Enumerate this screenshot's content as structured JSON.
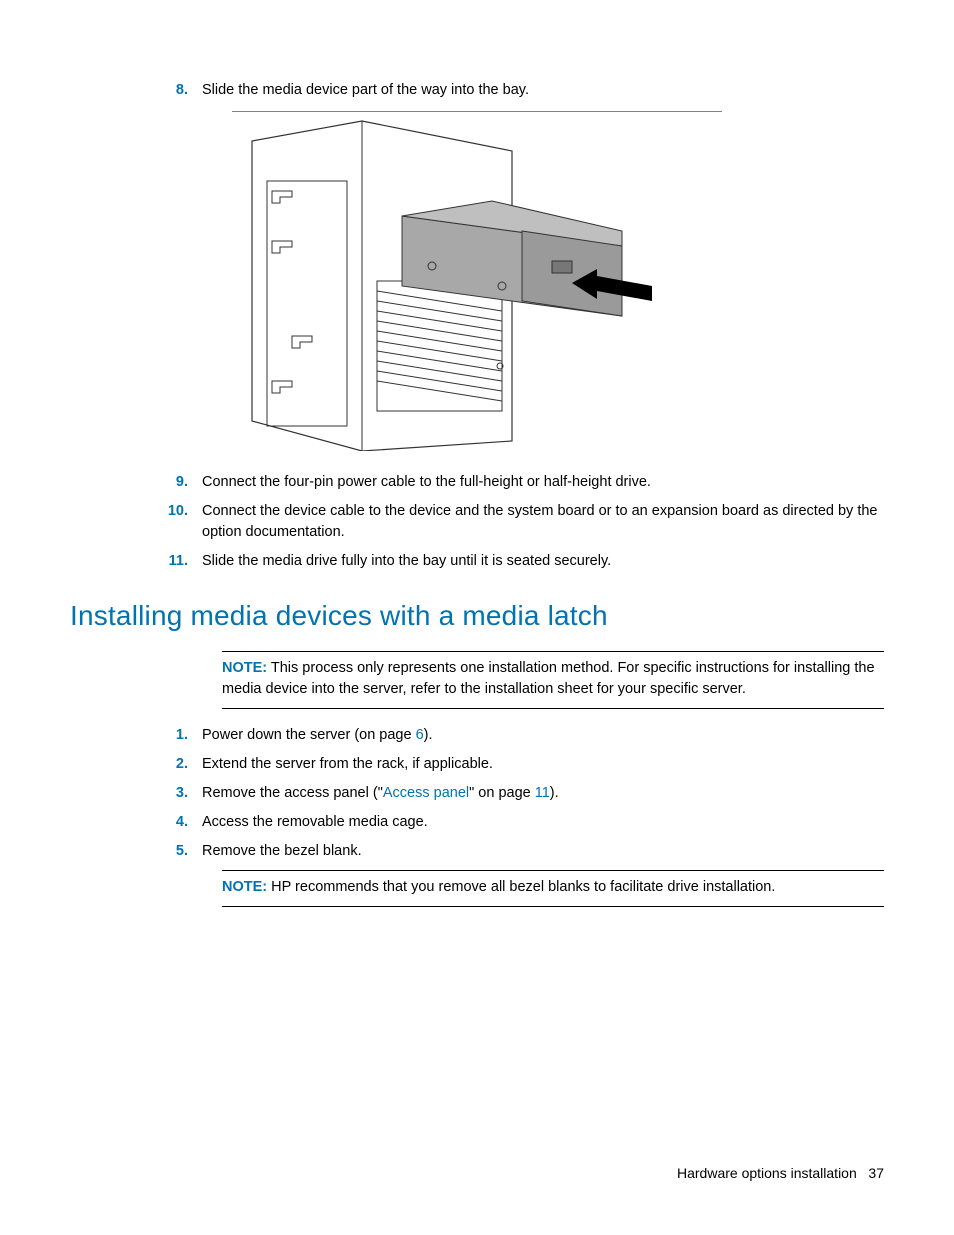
{
  "steps_a": {
    "s8": {
      "num": "8.",
      "text": "Slide the media device part of the way into the bay."
    },
    "s9": {
      "num": "9.",
      "text": "Connect the four-pin power cable to the full-height or half-height drive."
    },
    "s10": {
      "num": "10.",
      "text": "Connect the device cable to the device and the system board or to an expansion board as directed by the option documentation."
    },
    "s11": {
      "num": "11.",
      "text": "Slide the media drive fully into the bay until it is seated securely."
    }
  },
  "heading": "Installing media devices with a media latch",
  "note1": {
    "label": "NOTE:",
    "text": "  This process only represents one installation method. For specific instructions for installing the media device into the server, refer to the installation sheet for your specific server."
  },
  "steps_b": {
    "s1": {
      "num": "1.",
      "t1": "Power down the server (on page ",
      "link": "6",
      "t2": ")."
    },
    "s2": {
      "num": "2.",
      "text": "Extend the server from the rack, if applicable."
    },
    "s3": {
      "num": "3.",
      "t1": "Remove the access panel (\"",
      "link1": "Access panel",
      "t2": "\" on page ",
      "link2": "11",
      "t3": ")."
    },
    "s4": {
      "num": "4.",
      "text": "Access the removable media cage."
    },
    "s5": {
      "num": "5.",
      "text": "Remove the bezel blank."
    }
  },
  "note2": {
    "label": "NOTE:",
    "text": "  HP recommends that you remove all bezel blanks to facilitate drive installation."
  },
  "footer": {
    "section": "Hardware options installation",
    "page": "37"
  }
}
